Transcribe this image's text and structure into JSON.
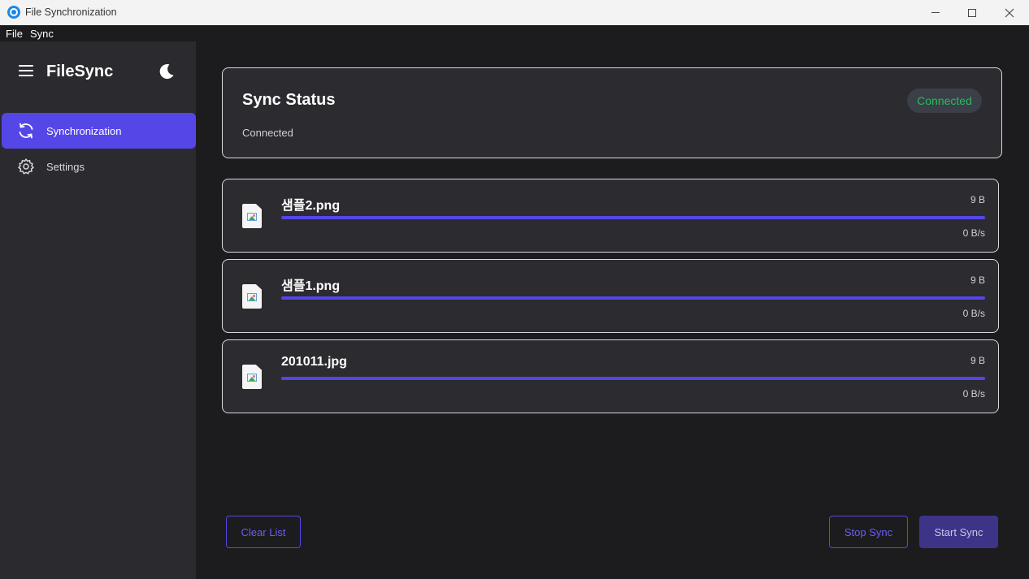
{
  "window": {
    "title": "File Synchronization"
  },
  "menu": {
    "file": "File",
    "sync": "Sync"
  },
  "sidebar": {
    "brand": "FileSync",
    "items": [
      {
        "label": "Synchronization",
        "icon": "sync-icon",
        "active": true
      },
      {
        "label": "Settings",
        "icon": "gear-icon",
        "active": false
      }
    ]
  },
  "status": {
    "title": "Sync Status",
    "subtitle": "Connected",
    "badge": "Connected",
    "badge_color": "#2eb85c"
  },
  "files": [
    {
      "name": "샘플2.png",
      "size": "9 B",
      "speed": "0 B/s",
      "progress": 1.0
    },
    {
      "name": "샘플1.png",
      "size": "9 B",
      "speed": "0 B/s",
      "progress": 1.0
    },
    {
      "name": "201011.jpg",
      "size": "9 B",
      "speed": "0 B/s",
      "progress": 1.0
    }
  ],
  "actions": {
    "clear": "Clear List",
    "stop": "Stop Sync",
    "start": "Start Sync"
  },
  "colors": {
    "accent": "#5546e8",
    "background": "#1c1c1f",
    "sidebar": "#2a2a2f"
  }
}
